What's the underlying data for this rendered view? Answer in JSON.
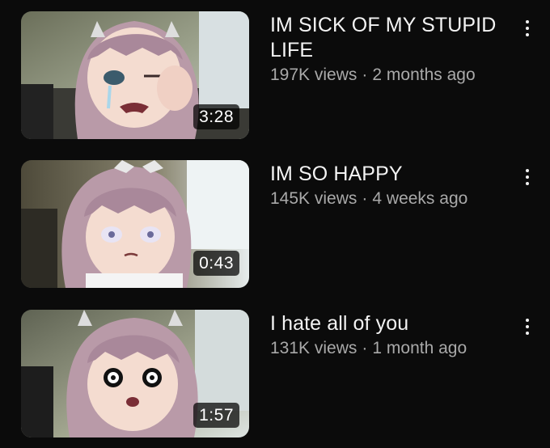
{
  "videos": [
    {
      "title": "IM SICK OF MY STUPID LIFE",
      "views": "197K views",
      "separator": "·",
      "age": "2 months ago",
      "duration": "3:28",
      "thumbnail_icon": "crying-anime-girl-thumbnail"
    },
    {
      "title": "IM SO HAPPY",
      "views": "145K views",
      "separator": "·",
      "age": "4 weeks ago",
      "duration": "0:43",
      "thumbnail_icon": "blank-stare-anime-girl-thumbnail"
    },
    {
      "title": "I hate all of you",
      "views": "131K views",
      "separator": "·",
      "age": "1 month ago",
      "duration": "1:57",
      "thumbnail_icon": "shocked-anime-girl-thumbnail"
    }
  ],
  "more_icon": "more-vertical-icon",
  "colors": {
    "background": "#0b0b0b",
    "title": "#f3f3f3",
    "meta": "#a9a9a9",
    "hair": "#b99aa8"
  }
}
